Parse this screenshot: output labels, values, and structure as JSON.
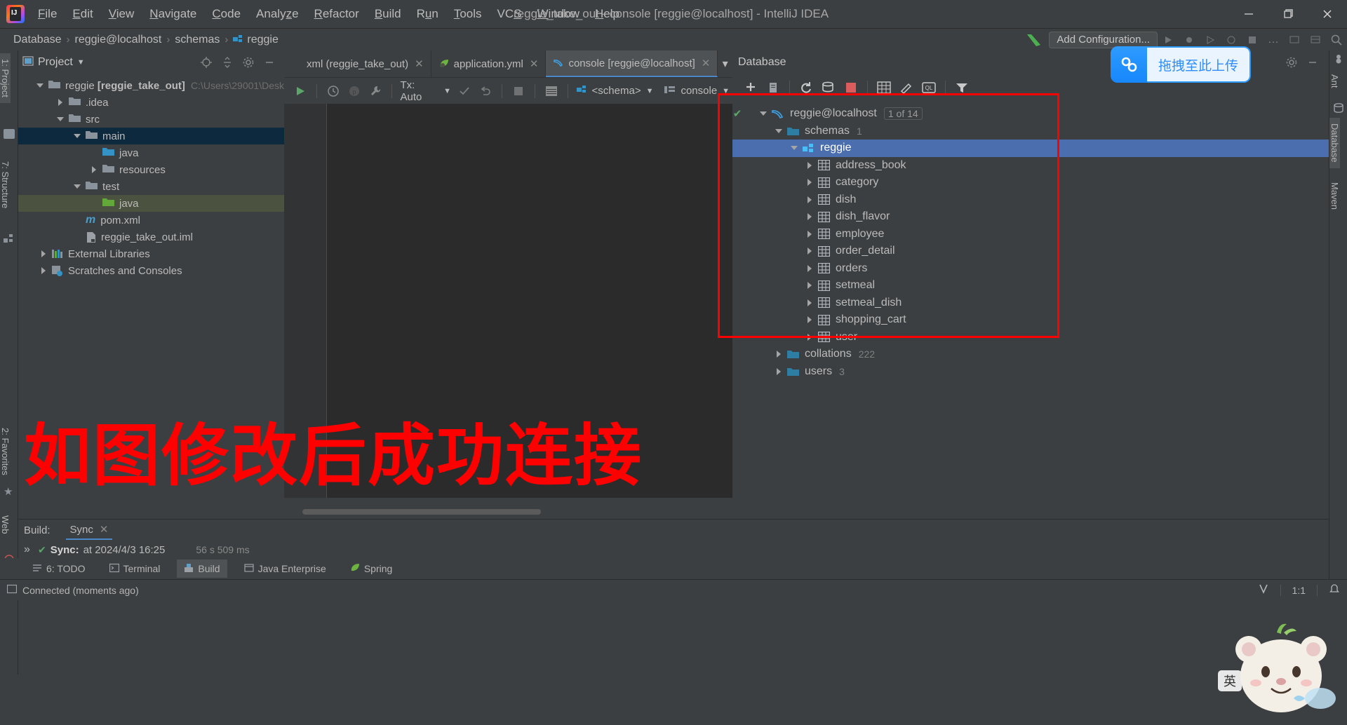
{
  "window": {
    "title": "reggie_take_out - console [reggie@localhost] - IntelliJ IDEA",
    "minimize": "–",
    "maximize": "❐",
    "close": "✕"
  },
  "menu": [
    {
      "label": "File",
      "mnemonic": "F"
    },
    {
      "label": "Edit",
      "mnemonic": "E"
    },
    {
      "label": "View",
      "mnemonic": "V"
    },
    {
      "label": "Navigate",
      "mnemonic": "N"
    },
    {
      "label": "Code",
      "mnemonic": "C"
    },
    {
      "label": "Analyze",
      "mnemonic": "z"
    },
    {
      "label": "Refactor",
      "mnemonic": "R"
    },
    {
      "label": "Build",
      "mnemonic": "B"
    },
    {
      "label": "Run",
      "mnemonic": "u"
    },
    {
      "label": "Tools",
      "mnemonic": "T"
    },
    {
      "label": "VCS",
      "mnemonic": "S"
    },
    {
      "label": "Window",
      "mnemonic": "W"
    },
    {
      "label": "Help",
      "mnemonic": "H"
    }
  ],
  "navbar": {
    "breadcrumbs": [
      "Database",
      "reggie@localhost",
      "schemas",
      "reggie"
    ],
    "separator": "›",
    "add_configuration": "Add Configuration..."
  },
  "left_strip": [
    {
      "label": "1: Project",
      "active": true
    },
    {
      "label": "7: Structure",
      "active": false
    },
    {
      "label": "2: Favorites",
      "active": false
    },
    {
      "label": "Web",
      "active": false
    }
  ],
  "right_strip": [
    {
      "label": "Ant",
      "active": false
    },
    {
      "label": "Database",
      "active": true
    },
    {
      "label": "Maven",
      "active": false
    }
  ],
  "project": {
    "title": "Project",
    "tree": [
      {
        "label": "reggie [reggie_take_out]",
        "path": "C:\\Users\\29001\\Desk",
        "indent": 0,
        "arrow": "down",
        "icon": "f-grey",
        "bold_part": "[reggie_take_out]",
        "selected": ""
      },
      {
        "label": ".idea",
        "path": "",
        "indent": 1,
        "arrow": "right",
        "icon": "f-grey",
        "selected": ""
      },
      {
        "label": "src",
        "path": "",
        "indent": 1,
        "arrow": "down",
        "icon": "f-grey",
        "selected": ""
      },
      {
        "label": "main",
        "path": "",
        "indent": 2,
        "arrow": "down",
        "icon": "f-grey",
        "selected": "blue"
      },
      {
        "label": "java",
        "path": "",
        "indent": 3,
        "arrow": "none",
        "icon": "f-blue",
        "selected": ""
      },
      {
        "label": "resources",
        "path": "",
        "indent": 3,
        "arrow": "right",
        "icon": "f-grey",
        "selected": ""
      },
      {
        "label": "test",
        "path": "",
        "indent": 2,
        "arrow": "down",
        "icon": "f-grey",
        "selected": ""
      },
      {
        "label": "java",
        "path": "",
        "indent": 3,
        "arrow": "none",
        "icon": "f-green",
        "selected": "green"
      },
      {
        "label": "pom.xml",
        "path": "",
        "indent": 2,
        "arrow": "none",
        "icon": "maven",
        "selected": ""
      },
      {
        "label": "reggie_take_out.iml",
        "path": "",
        "indent": 2,
        "arrow": "none",
        "icon": "iml",
        "selected": ""
      },
      {
        "label": "External Libraries",
        "path": "",
        "indent": 0,
        "arrow": "right",
        "icon": "lib",
        "selected": ""
      },
      {
        "label": "Scratches and Consoles",
        "path": "",
        "indent": 0,
        "arrow": "right",
        "icon": "scratch",
        "selected": ""
      }
    ]
  },
  "editor": {
    "tabs": [
      {
        "label": "xml (reggie_take_out)",
        "icon": "xml-icon",
        "active": false,
        "closable": true
      },
      {
        "label": "application.yml",
        "icon": "spring-icon",
        "active": false,
        "closable": true
      },
      {
        "label": "console [reggie@localhost]",
        "icon": "mysql-icon",
        "active": true,
        "closable": true
      }
    ],
    "toolbar": {
      "run_label": "Execute",
      "tx_label": "Tx: Auto",
      "schema_label": "<schema>",
      "session_label": "console"
    }
  },
  "database": {
    "title": "Database",
    "tree": [
      {
        "label": "reggie@localhost",
        "indent": 0,
        "arrow": "down",
        "icon": "mysql",
        "chip": "1 of 14",
        "badge": "",
        "selected": false,
        "check": true
      },
      {
        "label": "schemas",
        "indent": 1,
        "arrow": "down",
        "icon": "folder-blue",
        "chip": "",
        "badge": "1",
        "selected": false,
        "check": false
      },
      {
        "label": "reggie",
        "indent": 2,
        "arrow": "down",
        "icon": "schema",
        "chip": "",
        "badge": "",
        "selected": true,
        "check": false
      },
      {
        "label": "address_book",
        "indent": 3,
        "arrow": "right",
        "icon": "table",
        "chip": "",
        "badge": "",
        "selected": false,
        "check": false
      },
      {
        "label": "category",
        "indent": 3,
        "arrow": "right",
        "icon": "table",
        "chip": "",
        "badge": "",
        "selected": false,
        "check": false
      },
      {
        "label": "dish",
        "indent": 3,
        "arrow": "right",
        "icon": "table",
        "chip": "",
        "badge": "",
        "selected": false,
        "check": false
      },
      {
        "label": "dish_flavor",
        "indent": 3,
        "arrow": "right",
        "icon": "table",
        "chip": "",
        "badge": "",
        "selected": false,
        "check": false
      },
      {
        "label": "employee",
        "indent": 3,
        "arrow": "right",
        "icon": "table",
        "chip": "",
        "badge": "",
        "selected": false,
        "check": false
      },
      {
        "label": "order_detail",
        "indent": 3,
        "arrow": "right",
        "icon": "table",
        "chip": "",
        "badge": "",
        "selected": false,
        "check": false
      },
      {
        "label": "orders",
        "indent": 3,
        "arrow": "right",
        "icon": "table",
        "chip": "",
        "badge": "",
        "selected": false,
        "check": false
      },
      {
        "label": "setmeal",
        "indent": 3,
        "arrow": "right",
        "icon": "table",
        "chip": "",
        "badge": "",
        "selected": false,
        "check": false
      },
      {
        "label": "setmeal_dish",
        "indent": 3,
        "arrow": "right",
        "icon": "table",
        "chip": "",
        "badge": "",
        "selected": false,
        "check": false
      },
      {
        "label": "shopping_cart",
        "indent": 3,
        "arrow": "right",
        "icon": "table",
        "chip": "",
        "badge": "",
        "selected": false,
        "check": false
      },
      {
        "label": "user",
        "indent": 3,
        "arrow": "right",
        "icon": "table",
        "chip": "",
        "badge": "",
        "selected": false,
        "check": false
      },
      {
        "label": "collations",
        "indent": 1,
        "arrow": "right",
        "icon": "folder-blue",
        "chip": "",
        "badge": "222",
        "selected": false,
        "check": false
      },
      {
        "label": "users",
        "indent": 1,
        "arrow": "right",
        "icon": "folder-blue",
        "chip": "",
        "badge": "3",
        "selected": false,
        "check": false
      }
    ]
  },
  "annotation": {
    "big_text": "如图修改后成功连接",
    "rect_color": "#ff0000"
  },
  "build": {
    "label": "Build:",
    "tab": "Sync",
    "close": "✕",
    "status_text": "Sync:",
    "status_detail": "at 2024/4/3 16:25",
    "duration": "56 s 509 ms",
    "more": "»"
  },
  "bottom_strip": [
    {
      "label": "6: TODO",
      "icon": "todo-icon",
      "active": false
    },
    {
      "label": "Terminal",
      "icon": "terminal-icon",
      "active": false
    },
    {
      "label": "Build",
      "icon": "build-icon",
      "active": true
    },
    {
      "label": "Java Enterprise",
      "icon": "java-ee-icon",
      "active": false
    },
    {
      "label": "Spring",
      "icon": "spring-icon",
      "active": false
    }
  ],
  "statusbar": {
    "message": "Connected (moments ago)",
    "caret": "1:1",
    "branch_icon": "vcs-branch-icon"
  },
  "baidu_widget": {
    "text": "拖拽至此上传"
  },
  "ime": {
    "label": "英"
  },
  "colors": {
    "accent_blue": "#4b6eaf",
    "annotation_red": "#ff0000",
    "green_run": "#59a869",
    "panel_bg": "#3c3f41",
    "editor_bg": "#2b2b2b"
  }
}
